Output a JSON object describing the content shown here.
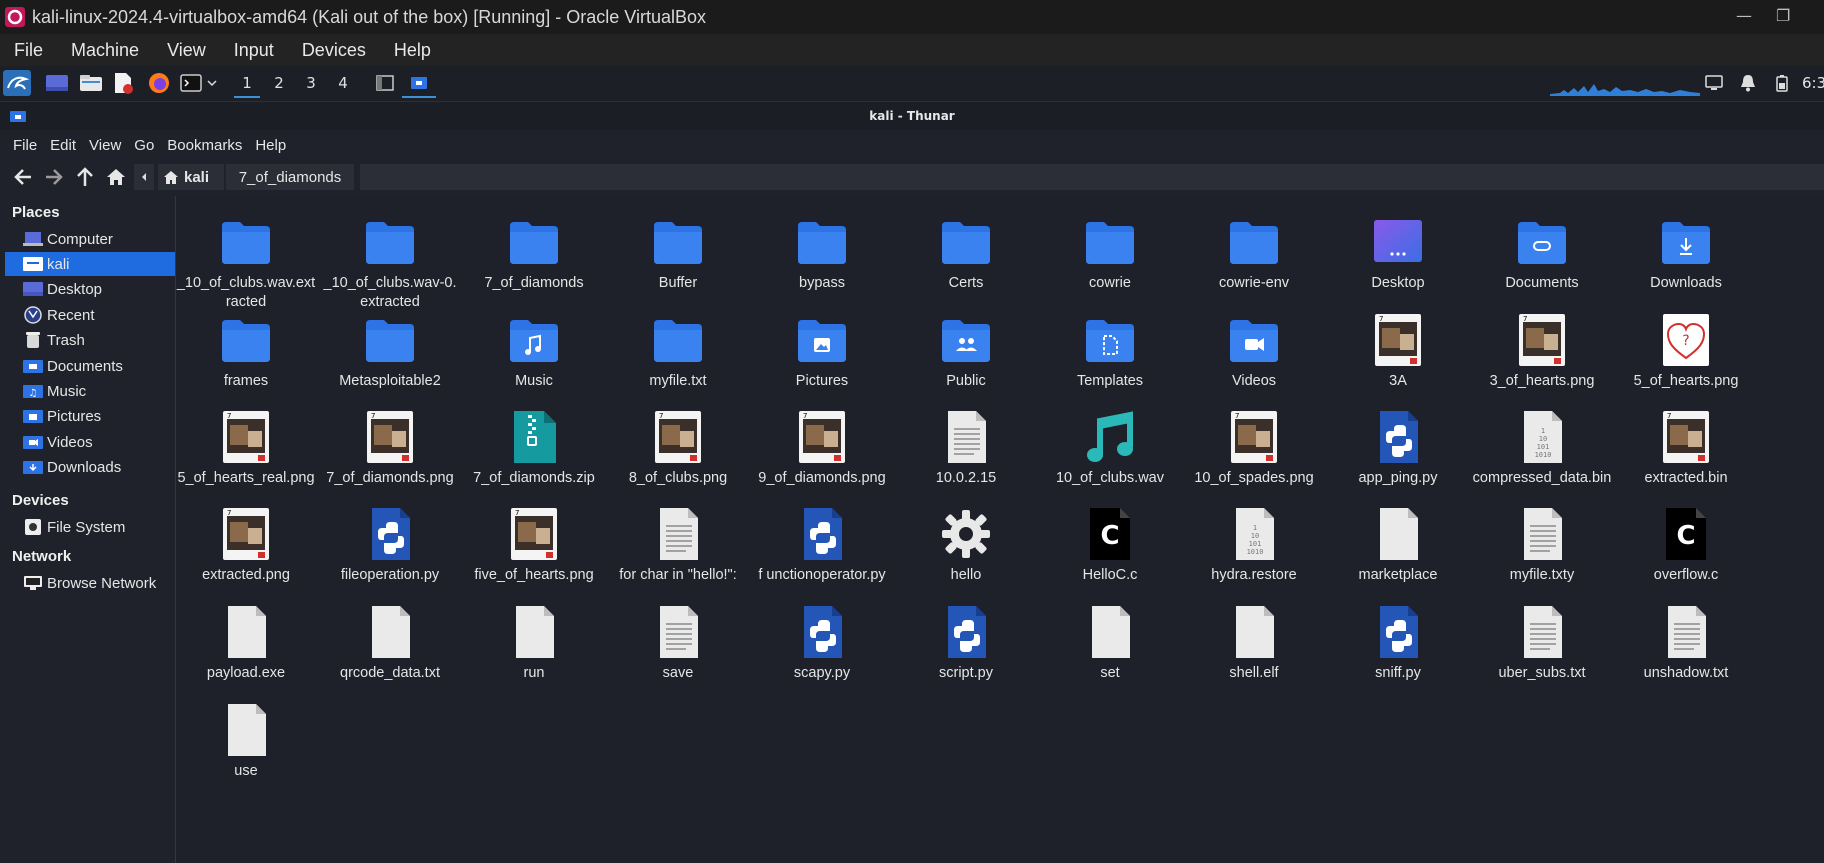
{
  "window": {
    "title": "kali-linux-2024.4-virtualbox-amd64 (Kali out of the box) [Running] - Oracle VirtualBox",
    "minimize": "—",
    "maximize": "❐"
  },
  "vb_menu": [
    "File",
    "Machine",
    "View",
    "Input",
    "Devices",
    "Help"
  ],
  "panel": {
    "workspaces": [
      "1",
      "2",
      "3",
      "4"
    ],
    "active_workspace": "1",
    "clock": "6:3"
  },
  "thunar": {
    "title": "kali - Thunar",
    "menu": [
      "File",
      "Edit",
      "View",
      "Go",
      "Bookmarks",
      "Help"
    ],
    "breadcrumb": {
      "home": "kali",
      "current": "7_of_diamonds"
    }
  },
  "sidebar": {
    "places_heading": "Places",
    "places": [
      {
        "label": "Computer",
        "icon": "computer-icon"
      },
      {
        "label": "kali",
        "icon": "home-folder-icon",
        "selected": true
      },
      {
        "label": "Desktop",
        "icon": "desktop-icon"
      },
      {
        "label": "Recent",
        "icon": "recent-icon"
      },
      {
        "label": "Trash",
        "icon": "trash-icon"
      },
      {
        "label": "Documents",
        "icon": "documents-icon"
      },
      {
        "label": "Music",
        "icon": "music-icon"
      },
      {
        "label": "Pictures",
        "icon": "pictures-icon"
      },
      {
        "label": "Videos",
        "icon": "videos-icon"
      },
      {
        "label": "Downloads",
        "icon": "downloads-icon"
      }
    ],
    "devices_heading": "Devices",
    "devices": [
      {
        "label": "File System",
        "icon": "drive-icon"
      }
    ],
    "network_heading": "Network",
    "network": [
      {
        "label": "Browse Network",
        "icon": "network-icon"
      }
    ]
  },
  "files": [
    {
      "name": "_10_of_clubs.wav.extracted",
      "icon": "folder"
    },
    {
      "name": "_10_of_clubs.wav-0.extracted",
      "icon": "folder"
    },
    {
      "name": "7_of_diamonds",
      "icon": "folder"
    },
    {
      "name": "Buffer",
      "icon": "folder"
    },
    {
      "name": "bypass",
      "icon": "folder"
    },
    {
      "name": "Certs",
      "icon": "folder"
    },
    {
      "name": "cowrie",
      "icon": "folder"
    },
    {
      "name": "cowrie-env",
      "icon": "folder"
    },
    {
      "name": "Desktop",
      "icon": "desktop-folder"
    },
    {
      "name": "Documents",
      "icon": "documents-folder"
    },
    {
      "name": "Downloads",
      "icon": "downloads-folder"
    },
    {
      "name": "frames",
      "icon": "folder"
    },
    {
      "name": "Metasploitable2",
      "icon": "folder"
    },
    {
      "name": "Music",
      "icon": "music-folder"
    },
    {
      "name": "myfile.txt",
      "icon": "folder"
    },
    {
      "name": "Pictures",
      "icon": "pictures-folder"
    },
    {
      "name": "Public",
      "icon": "public-folder"
    },
    {
      "name": "Templates",
      "icon": "templates-folder"
    },
    {
      "name": "Videos",
      "icon": "videos-folder"
    },
    {
      "name": "3A",
      "icon": "image-card"
    },
    {
      "name": "3_of_hearts.png",
      "icon": "image-card"
    },
    {
      "name": "5_of_hearts.png",
      "icon": "image-heart"
    },
    {
      "name": "5_of_hearts_real.png",
      "icon": "image-card"
    },
    {
      "name": "7_of_diamonds.png",
      "icon": "image-card"
    },
    {
      "name": "7_of_diamonds.zip",
      "icon": "zip"
    },
    {
      "name": "8_of_clubs.png",
      "icon": "image-card"
    },
    {
      "name": "9_of_diamonds.png",
      "icon": "image-card"
    },
    {
      "name": "10.0.2.15",
      "icon": "text"
    },
    {
      "name": "10_of_clubs.wav",
      "icon": "audio"
    },
    {
      "name": "10_of_spades.png",
      "icon": "image-card"
    },
    {
      "name": "app_ping.py",
      "icon": "python"
    },
    {
      "name": "compressed_data.bin",
      "icon": "binary"
    },
    {
      "name": "extracted.bin",
      "icon": "image-card"
    },
    {
      "name": "extracted.png",
      "icon": "image-card"
    },
    {
      "name": "fileoperation.py",
      "icon": "python"
    },
    {
      "name": "five_of_hearts.png",
      "icon": "image-card"
    },
    {
      "name": "for char in \"hello!\":",
      "icon": "text"
    },
    {
      "name": "f unctionoperator.py",
      "icon": "python"
    },
    {
      "name": "hello",
      "icon": "executable"
    },
    {
      "name": "HelloC.c",
      "icon": "c-source"
    },
    {
      "name": "hydra.restore",
      "icon": "binary"
    },
    {
      "name": "marketplace",
      "icon": "blank"
    },
    {
      "name": "myfile.txty",
      "icon": "text"
    },
    {
      "name": "overflow.c",
      "icon": "c-source"
    },
    {
      "name": "payload.exe",
      "icon": "blank"
    },
    {
      "name": "qrcode_data.txt",
      "icon": "blank"
    },
    {
      "name": "run",
      "icon": "blank"
    },
    {
      "name": "save",
      "icon": "text"
    },
    {
      "name": "scapy.py",
      "icon": "python"
    },
    {
      "name": "script.py",
      "icon": "python"
    },
    {
      "name": "set",
      "icon": "blank"
    },
    {
      "name": "shell.elf",
      "icon": "blank"
    },
    {
      "name": "sniff.py",
      "icon": "python"
    },
    {
      "name": "uber_subs.txt",
      "icon": "text"
    },
    {
      "name": "unshadow.txt",
      "icon": "text"
    },
    {
      "name": "use",
      "icon": "blank"
    }
  ],
  "colors": {
    "folder": "#2d73e6",
    "selection": "#1e6ce0",
    "accent": "#3d8fd6"
  }
}
